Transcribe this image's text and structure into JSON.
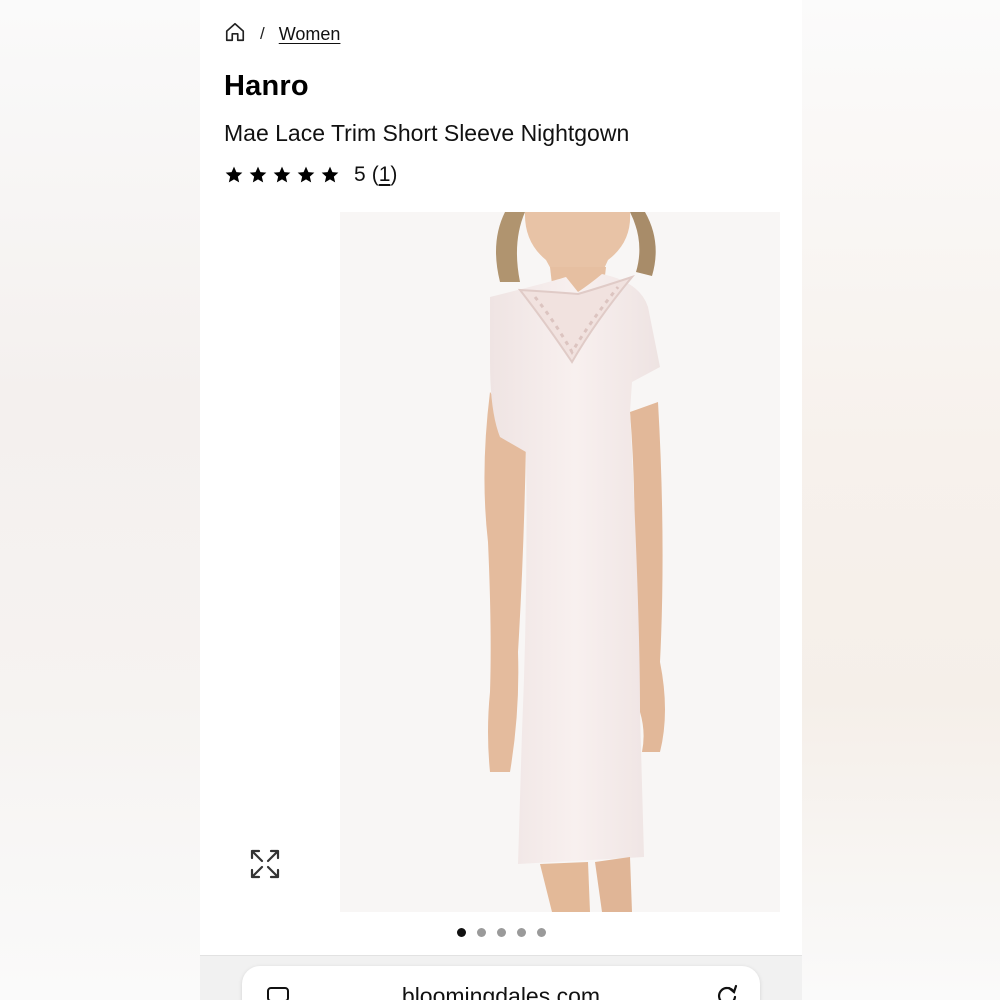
{
  "breadcrumb": {
    "separator": "/",
    "link_label": "Women"
  },
  "product": {
    "brand": "Hanro",
    "title": "Mae Lace Trim Short Sleeve Nightgown",
    "rating_value": "5",
    "review_count_open": "(",
    "review_count": "1",
    "review_count_close": ")",
    "stars_filled": 5
  },
  "gallery": {
    "image_count": 5,
    "active_index": 0
  },
  "browser": {
    "url": "bloomingdales.com"
  },
  "icons": {
    "home": "home-icon",
    "star": "star-icon",
    "expand": "expand-icon",
    "tabs": "tabs-icon",
    "reload": "reload-icon"
  },
  "colors": {
    "text": "#111111",
    "dot_active": "#111111",
    "dot_inactive": "#9a9a9a"
  }
}
